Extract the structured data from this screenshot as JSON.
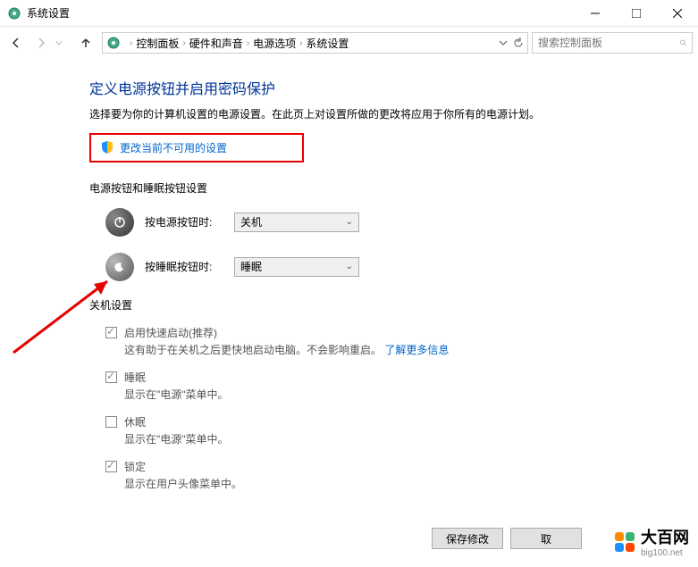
{
  "titlebar": {
    "title": "系统设置"
  },
  "breadcrumb": {
    "items": [
      "控制面板",
      "硬件和声音",
      "电源选项",
      "系统设置"
    ]
  },
  "search": {
    "placeholder": "搜索控制面板"
  },
  "main": {
    "heading": "定义电源按钮并启用密码保护",
    "subheading": "选择要为你的计算机设置的电源设置。在此页上对设置所做的更改将应用于你所有的电源计划。",
    "changeLink": "更改当前不可用的设置",
    "section1": "电源按钮和睡眠按钮设置",
    "powerBtn": {
      "label": "按电源按钮时:",
      "value": "关机"
    },
    "sleepBtn": {
      "label": "按睡眠按钮时:",
      "value": "睡眠"
    },
    "section2": "关机设置",
    "options": [
      {
        "title": "启用快速启动(推荐)",
        "desc": "这有助于在关机之后更快地启动电脑。不会影响重启。",
        "link": "了解更多信息",
        "checked": true
      },
      {
        "title": "睡眠",
        "desc": "显示在\"电源\"菜单中。",
        "checked": true
      },
      {
        "title": "休眠",
        "desc": "显示在\"电源\"菜单中。",
        "checked": false
      },
      {
        "title": "锁定",
        "desc": "显示在用户头像菜单中。",
        "checked": true
      }
    ]
  },
  "footer": {
    "save": "保存修改",
    "cancel": "取"
  },
  "watermark": {
    "brand": "大百网",
    "url": "big100.net"
  }
}
